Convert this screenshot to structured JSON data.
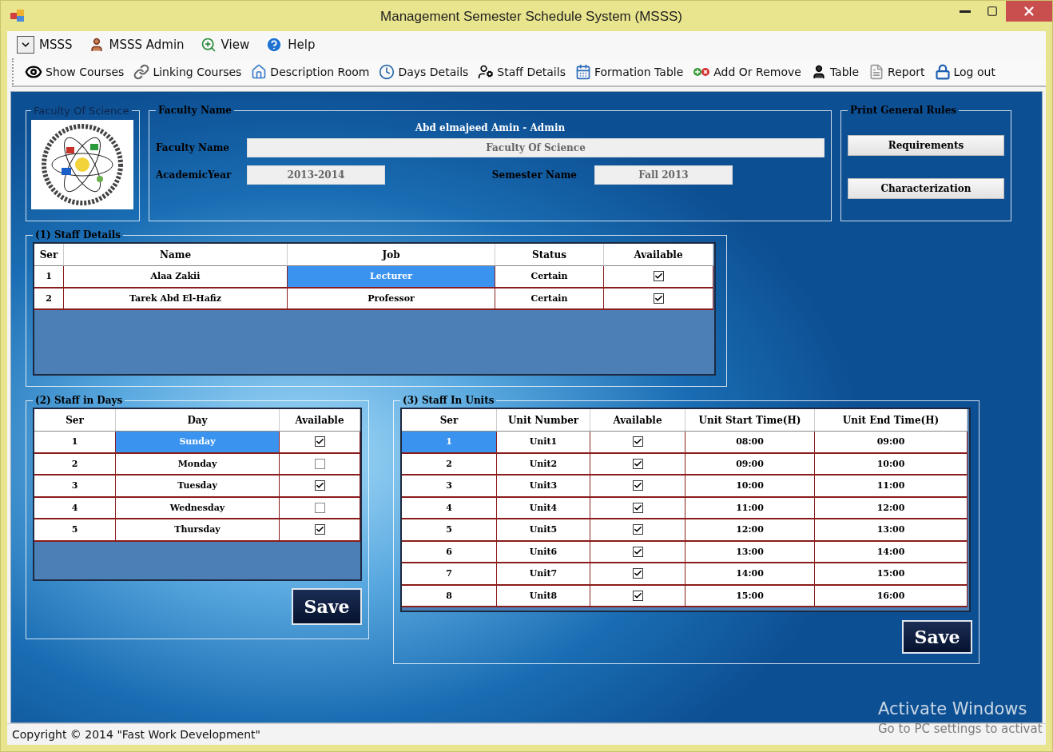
{
  "window": {
    "title": "Management Semester Schedule System (MSSS)"
  },
  "menu": [
    {
      "label": "MSSS",
      "kind": "dropdown"
    },
    {
      "label": "MSSS Admin",
      "kind": "admin"
    },
    {
      "label": "View",
      "kind": "view"
    },
    {
      "label": "Help",
      "kind": "help"
    }
  ],
  "toolbar": [
    {
      "label": "Show Courses",
      "kind": "eye"
    },
    {
      "label": "Linking Courses",
      "kind": "link"
    },
    {
      "label": "Description Room",
      "kind": "house"
    },
    {
      "label": "Days Details",
      "kind": "clock"
    },
    {
      "label": "Staff Details",
      "kind": "staff"
    },
    {
      "label": "Formation Table",
      "kind": "calendar"
    },
    {
      "label": "Add Or Remove",
      "kind": "addremove"
    },
    {
      "label": "Table",
      "kind": "person"
    },
    {
      "label": "Report",
      "kind": "report"
    },
    {
      "label": "Log out",
      "kind": "logout"
    }
  ],
  "faculty_logo": {
    "title": "Faculty Of Science"
  },
  "faculty": {
    "title": "Faculty Name",
    "user": "Abd elmajeed Amin - Admin",
    "fields": [
      {
        "label": "Faculty Name",
        "value": "Faculty Of Science"
      },
      {
        "label": "AcademicYear",
        "value": "2013-2014"
      },
      {
        "label": "Semester Name",
        "value": "Fall 2013"
      }
    ]
  },
  "print_rules": {
    "title": "Print General Rules",
    "buttons": [
      "Requirements",
      "Characterization"
    ]
  },
  "staff_details": {
    "title": "(1) Staff Details",
    "columns": [
      "Ser",
      "Name",
      "Job",
      "Status",
      "Available"
    ],
    "rows": [
      {
        "cells": [
          {
            "kind": "text",
            "text": "1",
            "selected": false
          },
          {
            "kind": "text",
            "text": "Alaa Zakii",
            "selected": false
          },
          {
            "kind": "text",
            "text": "Lecturer",
            "selected": true
          },
          {
            "kind": "text",
            "text": "Certain",
            "selected": false
          },
          {
            "kind": "check",
            "checked": true,
            "selected": false
          }
        ]
      },
      {
        "cells": [
          {
            "kind": "text",
            "text": "2",
            "selected": false
          },
          {
            "kind": "text",
            "text": "Tarek Abd El-Hafiz",
            "selected": false
          },
          {
            "kind": "text",
            "text": "Professor",
            "selected": false
          },
          {
            "kind": "text",
            "text": "Certain",
            "selected": false
          },
          {
            "kind": "check",
            "checked": true,
            "selected": false
          }
        ]
      }
    ]
  },
  "staff_in_days": {
    "title": "(2) Staff in Days",
    "columns": [
      "Ser",
      "Day",
      "Available"
    ],
    "save": "Save",
    "rows": [
      {
        "cells": [
          {
            "kind": "text",
            "text": "1",
            "selected": false
          },
          {
            "kind": "text",
            "text": "Sunday",
            "selected": true
          },
          {
            "kind": "check",
            "checked": true,
            "selected": false
          }
        ]
      },
      {
        "cells": [
          {
            "kind": "text",
            "text": "2",
            "selected": false
          },
          {
            "kind": "text",
            "text": "Monday",
            "selected": false
          },
          {
            "kind": "check",
            "checked": false,
            "selected": false
          }
        ]
      },
      {
        "cells": [
          {
            "kind": "text",
            "text": "3",
            "selected": false
          },
          {
            "kind": "text",
            "text": "Tuesday",
            "selected": false
          },
          {
            "kind": "check",
            "checked": true,
            "selected": false
          }
        ]
      },
      {
        "cells": [
          {
            "kind": "text",
            "text": "4",
            "selected": false
          },
          {
            "kind": "text",
            "text": "Wednesday",
            "selected": false
          },
          {
            "kind": "check",
            "checked": false,
            "selected": false
          }
        ]
      },
      {
        "cells": [
          {
            "kind": "text",
            "text": "5",
            "selected": false
          },
          {
            "kind": "text",
            "text": "Thursday",
            "selected": false
          },
          {
            "kind": "check",
            "checked": true,
            "selected": false
          }
        ]
      }
    ]
  },
  "staff_in_units": {
    "title": "(3) Staff In Units",
    "columns": [
      "Ser",
      "Unit Number",
      "Available",
      "Unit Start Time(H)",
      "Unit End Time(H)"
    ],
    "save": "Save",
    "rows": [
      {
        "cells": [
          {
            "kind": "text",
            "text": "1",
            "selected": true
          },
          {
            "kind": "text",
            "text": "Unit1",
            "selected": false
          },
          {
            "kind": "check",
            "checked": true,
            "selected": false
          },
          {
            "kind": "text",
            "text": "08:00",
            "selected": false
          },
          {
            "kind": "text",
            "text": "09:00",
            "selected": false
          }
        ]
      },
      {
        "cells": [
          {
            "kind": "text",
            "text": "2",
            "selected": false
          },
          {
            "kind": "text",
            "text": "Unit2",
            "selected": false
          },
          {
            "kind": "check",
            "checked": true,
            "selected": false
          },
          {
            "kind": "text",
            "text": "09:00",
            "selected": false
          },
          {
            "kind": "text",
            "text": "10:00",
            "selected": false
          }
        ]
      },
      {
        "cells": [
          {
            "kind": "text",
            "text": "3",
            "selected": false
          },
          {
            "kind": "text",
            "text": "Unit3",
            "selected": false
          },
          {
            "kind": "check",
            "checked": true,
            "selected": false
          },
          {
            "kind": "text",
            "text": "10:00",
            "selected": false
          },
          {
            "kind": "text",
            "text": "11:00",
            "selected": false
          }
        ]
      },
      {
        "cells": [
          {
            "kind": "text",
            "text": "4",
            "selected": false
          },
          {
            "kind": "text",
            "text": "Unit4",
            "selected": false
          },
          {
            "kind": "check",
            "checked": true,
            "selected": false
          },
          {
            "kind": "text",
            "text": "11:00",
            "selected": false
          },
          {
            "kind": "text",
            "text": "12:00",
            "selected": false
          }
        ]
      },
      {
        "cells": [
          {
            "kind": "text",
            "text": "5",
            "selected": false
          },
          {
            "kind": "text",
            "text": "Unit5",
            "selected": false
          },
          {
            "kind": "check",
            "checked": true,
            "selected": false
          },
          {
            "kind": "text",
            "text": "12:00",
            "selected": false
          },
          {
            "kind": "text",
            "text": "13:00",
            "selected": false
          }
        ]
      },
      {
        "cells": [
          {
            "kind": "text",
            "text": "6",
            "selected": false
          },
          {
            "kind": "text",
            "text": "Unit6",
            "selected": false
          },
          {
            "kind": "check",
            "checked": true,
            "selected": false
          },
          {
            "kind": "text",
            "text": "13:00",
            "selected": false
          },
          {
            "kind": "text",
            "text": "14:00",
            "selected": false
          }
        ]
      },
      {
        "cells": [
          {
            "kind": "text",
            "text": "7",
            "selected": false
          },
          {
            "kind": "text",
            "text": "Unit7",
            "selected": false
          },
          {
            "kind": "check",
            "checked": true,
            "selected": false
          },
          {
            "kind": "text",
            "text": "14:00",
            "selected": false
          },
          {
            "kind": "text",
            "text": "15:00",
            "selected": false
          }
        ]
      },
      {
        "cells": [
          {
            "kind": "text",
            "text": "8",
            "selected": false
          },
          {
            "kind": "text",
            "text": "Unit8",
            "selected": false
          },
          {
            "kind": "check",
            "checked": true,
            "selected": false
          },
          {
            "kind": "text",
            "text": "15:00",
            "selected": false
          },
          {
            "kind": "text",
            "text": "16:00",
            "selected": false
          }
        ]
      }
    ]
  },
  "status_bar": {
    "text": "Copyright © 2014 \"Fast Work Development\""
  },
  "os_notice": {
    "title": "Activate Windows",
    "text": "Go to PC settings to activat"
  }
}
